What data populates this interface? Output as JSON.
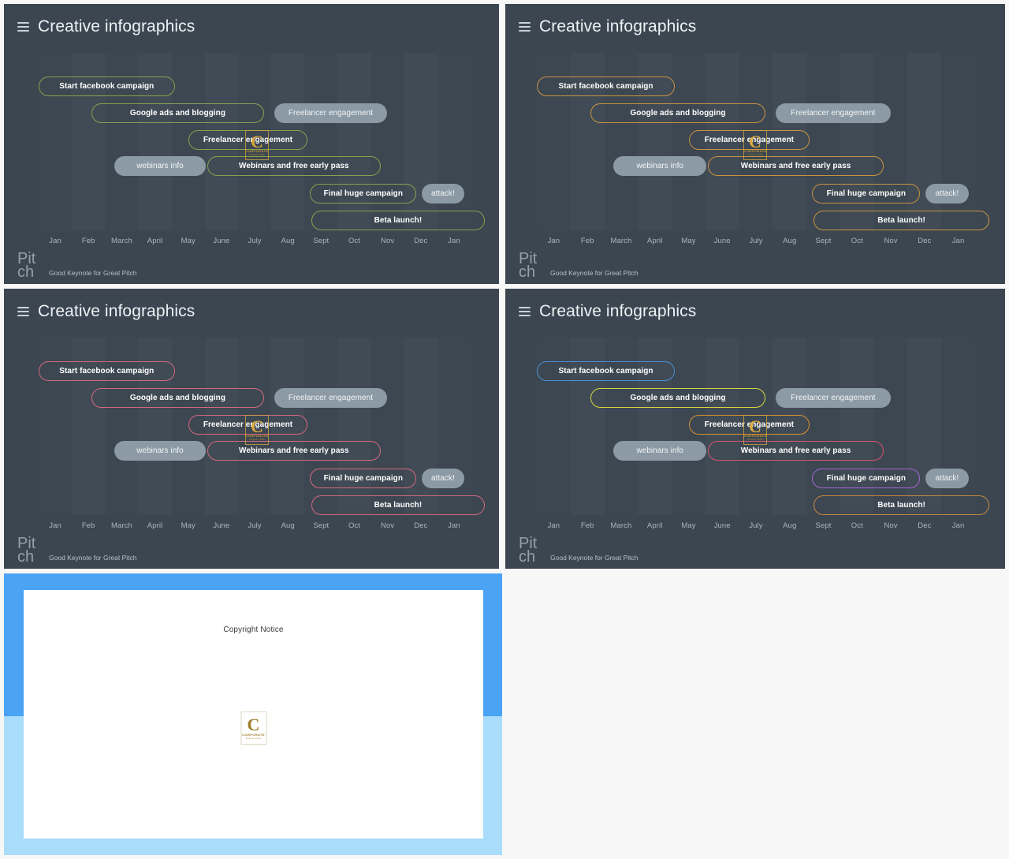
{
  "slides": [
    {
      "id": "slide-green",
      "title": "Creative infographics",
      "menu_icon": "hamburger-icon",
      "accent": "#86a24e",
      "footer": {
        "brand": "Pitch",
        "tagline": "Good Keynote for Great Pitch"
      },
      "bars": [
        {
          "label": "Start facebook campaign",
          "style": "outline",
          "color": "#86a24e",
          "row": 0,
          "start": 0.0,
          "width": 0.315
        },
        {
          "label": "Google ads and blogging",
          "style": "outline",
          "color": "#86a24e",
          "row": 1,
          "start": 0.122,
          "width": 0.4
        },
        {
          "label": "Freelancer engagement",
          "style": "filled",
          "color": "#8b9aa5",
          "row": 1,
          "start": 0.545,
          "width": 0.262
        },
        {
          "label": "Freelancer engagement",
          "style": "outline",
          "color": "#86a24e",
          "row": 2,
          "start": 0.347,
          "width": 0.275
        },
        {
          "label": "webinars info",
          "style": "filled",
          "color": "#8b9aa5",
          "row": 3,
          "start": 0.175,
          "width": 0.212
        },
        {
          "label": "Webinars and free early pass",
          "style": "outline",
          "color": "#86a24e",
          "row": 3,
          "start": 0.39,
          "width": 0.402
        },
        {
          "label": "Final huge campaign",
          "style": "outline",
          "color": "#86a24e",
          "row": 4,
          "start": 0.628,
          "width": 0.247
        },
        {
          "label": "attack!",
          "style": "filled",
          "color": "#8b9aa5",
          "row": 4,
          "start": 0.887,
          "width": 0.098
        },
        {
          "label": "Beta launch!",
          "style": "outline",
          "color": "#86a24e",
          "row": 5,
          "start": 0.632,
          "width": 0.4
        }
      ]
    },
    {
      "id": "slide-orange",
      "title": "Creative infographics",
      "menu_icon": "hamburger-icon",
      "accent": "#c89342",
      "footer": {
        "brand": "Pitch",
        "tagline": "Good Keynote for Great Pitch"
      },
      "bars": [
        {
          "label": "Start facebook campaign",
          "style": "outline",
          "color": "#c89342",
          "row": 0,
          "start": 0.0,
          "width": 0.315
        },
        {
          "label": "Google ads and blogging",
          "style": "outline",
          "color": "#c89342",
          "row": 1,
          "start": 0.122,
          "width": 0.4
        },
        {
          "label": "Freelancer engagement",
          "style": "filled",
          "color": "#8b9aa5",
          "row": 1,
          "start": 0.545,
          "width": 0.262
        },
        {
          "label": "Freelancer engagement",
          "style": "outline",
          "color": "#c89342",
          "row": 2,
          "start": 0.347,
          "width": 0.275
        },
        {
          "label": "webinars info",
          "style": "filled",
          "color": "#8b9aa5",
          "row": 3,
          "start": 0.175,
          "width": 0.212
        },
        {
          "label": "Webinars and free early pass",
          "style": "outline",
          "color": "#c89342",
          "row": 3,
          "start": 0.39,
          "width": 0.402
        },
        {
          "label": "Final huge campaign",
          "style": "outline",
          "color": "#c89342",
          "row": 4,
          "start": 0.628,
          "width": 0.247
        },
        {
          "label": "attack!",
          "style": "filled",
          "color": "#8b9aa5",
          "row": 4,
          "start": 0.887,
          "width": 0.098
        },
        {
          "label": "Beta launch!",
          "style": "outline",
          "color": "#c89342",
          "row": 5,
          "start": 0.632,
          "width": 0.4
        }
      ]
    },
    {
      "id": "slide-pink",
      "title": "Creative infographics",
      "menu_icon": "hamburger-icon",
      "accent": "#d4687f",
      "footer": {
        "brand": "Pitch",
        "tagline": "Good Keynote for Great Pitch"
      },
      "bars": [
        {
          "label": "Start facebook campaign",
          "style": "outline",
          "color": "#d4687f",
          "row": 0,
          "start": 0.0,
          "width": 0.315
        },
        {
          "label": "Google ads and blogging",
          "style": "outline",
          "color": "#d4687f",
          "row": 1,
          "start": 0.122,
          "width": 0.4
        },
        {
          "label": "Freelancer engagement",
          "style": "filled",
          "color": "#8b9aa5",
          "row": 1,
          "start": 0.545,
          "width": 0.262
        },
        {
          "label": "Freelancer engagement",
          "style": "outline",
          "color": "#d4687f",
          "row": 2,
          "start": 0.347,
          "width": 0.275
        },
        {
          "label": "webinars info",
          "style": "filled",
          "color": "#8b9aa5",
          "row": 3,
          "start": 0.175,
          "width": 0.212
        },
        {
          "label": "Webinars and free early pass",
          "style": "outline",
          "color": "#d4687f",
          "row": 3,
          "start": 0.39,
          "width": 0.402
        },
        {
          "label": "Final huge campaign",
          "style": "outline",
          "color": "#d4687f",
          "row": 4,
          "start": 0.628,
          "width": 0.247
        },
        {
          "label": "attack!",
          "style": "filled",
          "color": "#8b9aa5",
          "row": 4,
          "start": 0.887,
          "width": 0.098
        },
        {
          "label": "Beta launch!",
          "style": "outline",
          "color": "#d4687f",
          "row": 5,
          "start": 0.632,
          "width": 0.4
        }
      ]
    },
    {
      "id": "slide-multicolor",
      "title": "Creative infographics",
      "menu_icon": "hamburger-icon",
      "accent": "#4a8fd4",
      "footer": {
        "brand": "Pitch",
        "tagline": "Good Keynote for Great Pitch"
      },
      "bars": [
        {
          "label": "Start facebook campaign",
          "style": "outline",
          "color": "#4a8fd4",
          "row": 0,
          "start": 0.0,
          "width": 0.315
        },
        {
          "label": "Google ads and blogging",
          "style": "outline",
          "color": "#d7d63f",
          "row": 1,
          "start": 0.122,
          "width": 0.4
        },
        {
          "label": "Freelancer engagement",
          "style": "filled",
          "color": "#8b9aa5",
          "row": 1,
          "start": 0.545,
          "width": 0.262
        },
        {
          "label": "Freelancer engagement",
          "style": "outline",
          "color": "#d98f2e",
          "row": 2,
          "start": 0.347,
          "width": 0.275
        },
        {
          "label": "webinars info",
          "style": "filled",
          "color": "#8b9aa5",
          "row": 3,
          "start": 0.175,
          "width": 0.212
        },
        {
          "label": "Webinars and free early pass",
          "style": "outline",
          "color": "#d4566f",
          "row": 3,
          "start": 0.39,
          "width": 0.402
        },
        {
          "label": "Final huge campaign",
          "style": "outline",
          "color": "#a468d4",
          "row": 4,
          "start": 0.628,
          "width": 0.247
        },
        {
          "label": "attack!",
          "style": "filled",
          "color": "#8b9aa5",
          "row": 4,
          "start": 0.887,
          "width": 0.098
        },
        {
          "label": "Beta launch!",
          "style": "outline",
          "color": "#cc8740",
          "row": 5,
          "start": 0.632,
          "width": 0.4
        }
      ]
    }
  ],
  "months": [
    "Jan",
    "Feb",
    "March",
    "April",
    "May",
    "June",
    "July",
    "Aug",
    "Sept",
    "Oct",
    "Nov",
    "Dec",
    "Jan"
  ],
  "watermark": {
    "letter": "C",
    "line1": "CORPORATE",
    "line2": "SINCE 1996"
  },
  "copyright_slide": {
    "title": "Copyright Notice",
    "logo": {
      "letter": "C",
      "line1": "CORPORATE",
      "line2": "SINCE 1996"
    },
    "band_color": "#4aa3f5",
    "band_color_bottom": "#aadcfb"
  },
  "chart_data": {
    "type": "bar",
    "title": "Creative infographics",
    "xlabel": "",
    "ylabel": "",
    "categories": [
      "Jan",
      "Feb",
      "March",
      "April",
      "May",
      "June",
      "July",
      "Aug",
      "Sept",
      "Oct",
      "Nov",
      "Dec",
      "Jan"
    ],
    "tasks": [
      {
        "name": "Start facebook campaign",
        "row": 0,
        "start_month": "Jan",
        "end_month": "April",
        "start_frac": 0.0,
        "end_frac": 0.315
      },
      {
        "name": "Google ads and blogging",
        "row": 1,
        "start_month": "Feb",
        "end_month": "June",
        "start_frac": 0.122,
        "end_frac": 0.522
      },
      {
        "name": "Freelancer engagement",
        "row": 1,
        "start_month": "July",
        "end_month": "Sept",
        "start_frac": 0.545,
        "end_frac": 0.807
      },
      {
        "name": "Freelancer engagement",
        "row": 2,
        "start_month": "May",
        "end_month": "Aug",
        "start_frac": 0.347,
        "end_frac": 0.622
      },
      {
        "name": "webinars info",
        "row": 3,
        "start_month": "March",
        "end_month": "May",
        "start_frac": 0.175,
        "end_frac": 0.387
      },
      {
        "name": "Webinars and free early pass",
        "row": 3,
        "start_month": "June",
        "end_month": "Oct",
        "start_frac": 0.39,
        "end_frac": 0.792
      },
      {
        "name": "Final huge campaign",
        "row": 4,
        "start_month": "Sept",
        "end_month": "Nov",
        "start_frac": 0.628,
        "end_frac": 0.875
      },
      {
        "name": "attack!",
        "row": 4,
        "start_month": "Dec",
        "end_month": "Dec",
        "start_frac": 0.887,
        "end_frac": 0.985
      },
      {
        "name": "Beta launch!",
        "row": 5,
        "start_month": "Sept",
        "end_month": "Jan",
        "start_frac": 0.632,
        "end_frac": 1.032
      }
    ],
    "grid": true,
    "legend": "none"
  }
}
